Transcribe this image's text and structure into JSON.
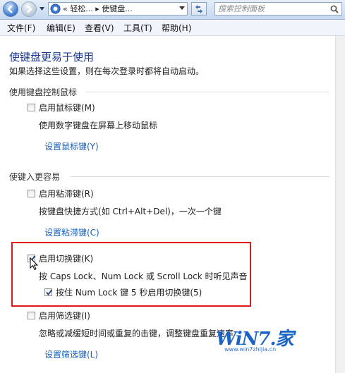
{
  "address_bar": {
    "path": "«  轻松...  ▸  使键盘...",
    "search_placeholder": "搜索控制面板"
  },
  "menu": [
    "文件(F)",
    "编辑(E)",
    "查看(V)",
    "工具(T)",
    "帮助(H)"
  ],
  "page": {
    "title": "使键盘更易于使用",
    "description": "如果选择这些设置，则在每次登录时都将自动启动。"
  },
  "sections": {
    "mouse": {
      "heading": "使用键盘控制鼠标",
      "mouse_keys": {
        "label": "启用鼠标键(M)",
        "checked": false
      },
      "mouse_keys_desc": "使用数字键盘在屏幕上移动鼠标",
      "mouse_keys_link": "设置鼠标键(Y)"
    },
    "typing": {
      "heading": "使键入更容易",
      "sticky_keys": {
        "label": "启用粘滞键(R)",
        "checked": false
      },
      "sticky_keys_desc": "按键盘快捷方式(如 Ctrl+Alt+Del)，一次一个键",
      "sticky_keys_link": "设置粘滞键(C)",
      "toggle_keys": {
        "label": "启用切换键(K)",
        "checked": true
      },
      "toggle_keys_desc": "按 Caps Lock、Num Lock 或 Scroll Lock 时听见声音",
      "toggle_keys_sub": {
        "label": "按住 Num Lock 键 5 秒启用切换键(5)",
        "checked": true
      },
      "filter_keys": {
        "label": "启用筛选键(I)",
        "checked": false
      },
      "filter_keys_desc": "忽略或减缓短时间或重复的击键，调整键盘重复速率",
      "filter_keys_link": "设置筛选键(L)"
    }
  },
  "watermark": {
    "logo": "WiN7.家",
    "url": "www.win7zhijia.cn"
  },
  "colors": {
    "link": "#1560c0",
    "title": "#1e3a8c",
    "highlight": "#e01818"
  }
}
